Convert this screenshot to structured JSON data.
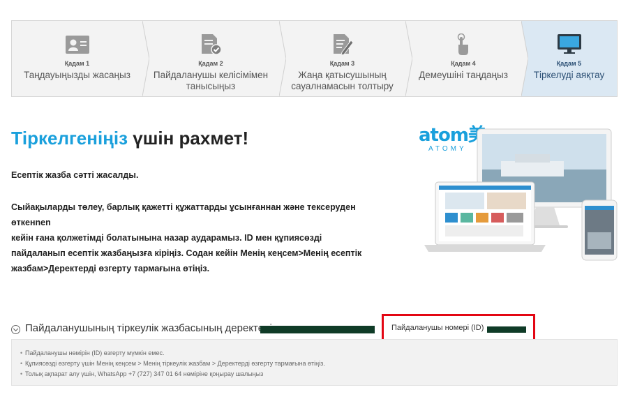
{
  "steps": [
    {
      "num": "Қадам 1",
      "label": "Таңдауыңызды жасаңыз",
      "icon": "person-card-icon",
      "active": false
    },
    {
      "num": "Қадам 2",
      "label": "Пайдаланушы келісімімен танысыңыз",
      "icon": "document-check-icon",
      "active": false
    },
    {
      "num": "Қадам 3",
      "label": "Жаңа қатысушының сауалнамасын толтыру",
      "icon": "document-pen-icon",
      "active": false
    },
    {
      "num": "Қадам 4",
      "label": "Демеушіні таңдаңыз",
      "icon": "hand-pointer-icon",
      "active": false
    },
    {
      "num": "Қадам 5",
      "label": "Тіркелуді аяқтау",
      "icon": "monitor-icon",
      "active": true
    }
  ],
  "main": {
    "title_highlight": "Тіркелгеніңіз",
    "title_rest": " үшін рахмет!",
    "para1": "Есептік жазба сәтті жасалды.",
    "para2_line1": "Сыйақыларды төлеу, барлық қажетті құжаттарды ұсынғаннан және тексеруден өткенnen",
    "para2_line2": "кейін ғана қолжетімді болатынына назар аударамыз. ID мен құпиясөзді пайдаланып есептік жазбаңызға кіріңіз. Содан кейін Менің кеңсем>Менің есептік жазбам>Деректерді өзгерту тармағына өтіңіз."
  },
  "brand": {
    "logo_text": "atom美",
    "logo_sub": "ATOMY",
    "accent": "#1aa0dc"
  },
  "account": {
    "title": "Пайдаланушының тіркеулік жазбасының деректері",
    "id_label": "Пайдаланушы номері (ID)",
    "notes": [
      "Пайдаланушы нөмірін (ID) өзгерту мүмкін емес.",
      "Құпиясөзді өзгерту үшін Менің кеңсем > Менің тіркеулік жазбам > Деректерді өзгерту тармағына өтіңіз.",
      "Толық ақпарат алу үшін, WhatsApp +7 (727) 347 01 64 нөміріне қоңырау шалыңыз"
    ]
  },
  "colors": {
    "highlight_box": "#e30613",
    "active_step_bg": "#dbe8f3",
    "redaction": "#0f3b27"
  }
}
